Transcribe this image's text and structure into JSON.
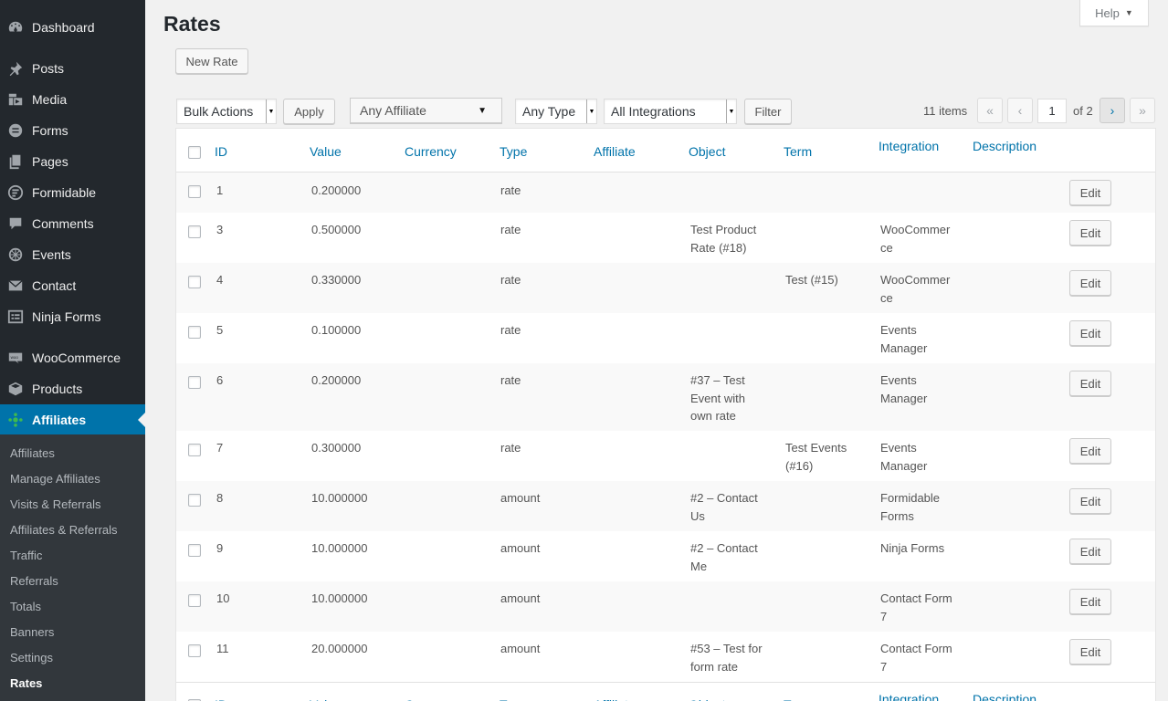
{
  "sidebar": {
    "items": [
      {
        "label": "Dashboard",
        "icon": "dashboard-icon"
      },
      {
        "label": "Posts",
        "icon": "pin-icon"
      },
      {
        "label": "Media",
        "icon": "media-icon"
      },
      {
        "label": "Forms",
        "icon": "forms-icon"
      },
      {
        "label": "Pages",
        "icon": "pages-icon"
      },
      {
        "label": "Formidable",
        "icon": "formidable-icon"
      },
      {
        "label": "Comments",
        "icon": "comment-icon"
      },
      {
        "label": "Events",
        "icon": "events-icon"
      },
      {
        "label": "Contact",
        "icon": "mail-icon"
      },
      {
        "label": "Ninja Forms",
        "icon": "ninja-forms-icon"
      },
      {
        "label": "WooCommerce",
        "icon": "woo-icon"
      },
      {
        "label": "Products",
        "icon": "box-icon"
      },
      {
        "label": "Affiliates",
        "icon": "affiliates-icon"
      }
    ],
    "submenu": [
      "Affiliates",
      "Manage Affiliates",
      "Visits & Referrals",
      "Affiliates & Referrals",
      "Traffic",
      "Referrals",
      "Totals",
      "Banners",
      "Settings",
      "Rates"
    ],
    "accent": "#0073aa"
  },
  "page": {
    "title": "Rates",
    "new_button": "New Rate",
    "help_label": "Help"
  },
  "toolbar": {
    "bulk_actions": "Bulk Actions",
    "apply": "Apply",
    "affiliate_filter": "Any Affiliate",
    "type_filter": "Any Type",
    "integration_filter": "All Integrations",
    "filter": "Filter",
    "items_count": "11 items",
    "current_page": "1",
    "page_of": "of 2",
    "first_page": "«",
    "prev_page": "‹",
    "next_page": "›",
    "last_page": "»"
  },
  "table": {
    "columns": [
      "ID",
      "Value",
      "Currency",
      "Type",
      "Affiliate",
      "Object",
      "Term",
      "Integration",
      "Description"
    ],
    "edit_label": "Edit",
    "rows": [
      {
        "id": "1",
        "value": "0.200000",
        "currency": "",
        "type": "rate",
        "affiliate": "",
        "object": "",
        "term": "",
        "integration": "",
        "description": ""
      },
      {
        "id": "3",
        "value": "0.500000",
        "currency": "",
        "type": "rate",
        "affiliate": "",
        "object": "Test Product Rate (#18)",
        "term": "",
        "integration": "WooCommerce",
        "description": ""
      },
      {
        "id": "4",
        "value": "0.330000",
        "currency": "",
        "type": "rate",
        "affiliate": "",
        "object": "",
        "term": "Test (#15)",
        "integration": "WooCommerce",
        "description": ""
      },
      {
        "id": "5",
        "value": "0.100000",
        "currency": "",
        "type": "rate",
        "affiliate": "",
        "object": "",
        "term": "",
        "integration": "Events Manager",
        "description": ""
      },
      {
        "id": "6",
        "value": "0.200000",
        "currency": "",
        "type": "rate",
        "affiliate": "",
        "object": "#37 – Test Event with own rate",
        "term": "",
        "integration": "Events Manager",
        "description": ""
      },
      {
        "id": "7",
        "value": "0.300000",
        "currency": "",
        "type": "rate",
        "affiliate": "",
        "object": "",
        "term": "Test Events (#16)",
        "integration": "Events Manager",
        "description": ""
      },
      {
        "id": "8",
        "value": "10.000000",
        "currency": "",
        "type": "amount",
        "affiliate": "",
        "object": "#2 – Contact Us",
        "term": "",
        "integration": "Formidable Forms",
        "description": ""
      },
      {
        "id": "9",
        "value": "10.000000",
        "currency": "",
        "type": "amount",
        "affiliate": "",
        "object": "#2 – Contact Me",
        "term": "",
        "integration": "Ninja Forms",
        "description": ""
      },
      {
        "id": "10",
        "value": "10.000000",
        "currency": "",
        "type": "amount",
        "affiliate": "",
        "object": "",
        "term": "",
        "integration": "Contact Form 7",
        "description": ""
      },
      {
        "id": "11",
        "value": "20.000000",
        "currency": "",
        "type": "amount",
        "affiliate": "",
        "object": "#53 – Test for form rate",
        "term": "",
        "integration": "Contact Form 7",
        "description": ""
      }
    ]
  }
}
